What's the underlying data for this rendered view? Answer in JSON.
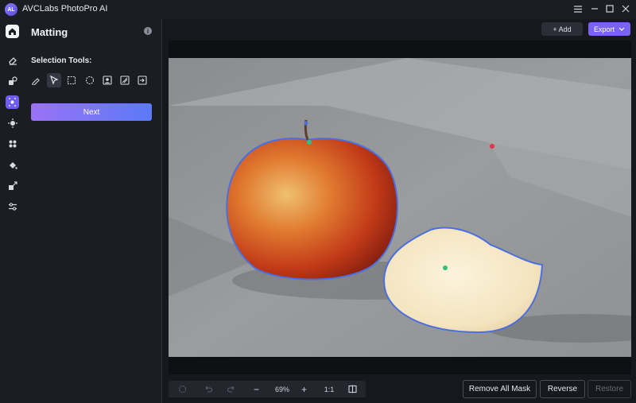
{
  "app": {
    "logo_text": "AL",
    "title": "AVCLabs PhotoPro AI"
  },
  "window_controls": [
    "menu-icon",
    "minimize-icon",
    "maximize-icon",
    "close-icon"
  ],
  "rail": [
    "home-icon",
    "eraser-icon",
    "replace-icon",
    "matting-icon",
    "enhance-icon",
    "ai-object-icon",
    "colorize-icon",
    "crop-icon",
    "adjust-icon"
  ],
  "panel": {
    "title": "Matting",
    "section_label": "Selection Tools:",
    "tools": [
      "brush-icon",
      "pointer-icon",
      "rect-select-icon",
      "ellipse-select-icon",
      "portrait-select-icon",
      "auto-select-icon",
      "import-icon"
    ],
    "active_tool": "pointer-icon",
    "next_label": "Next"
  },
  "toolbar": {
    "add_label": "+ Add",
    "export_label": "Export"
  },
  "bottom": {
    "zoom": "69%",
    "one_to_one": "1:1",
    "minus": "−",
    "plus": "+",
    "remove_all_label": "Remove All Mask",
    "reverse_label": "Reverse",
    "restore_label": "Restore"
  },
  "colors": {
    "accent": "#7a62f2",
    "mask_outline": "#4b6fe0",
    "include_point": "#2ec27e",
    "exclude_point": "#e0344f"
  }
}
